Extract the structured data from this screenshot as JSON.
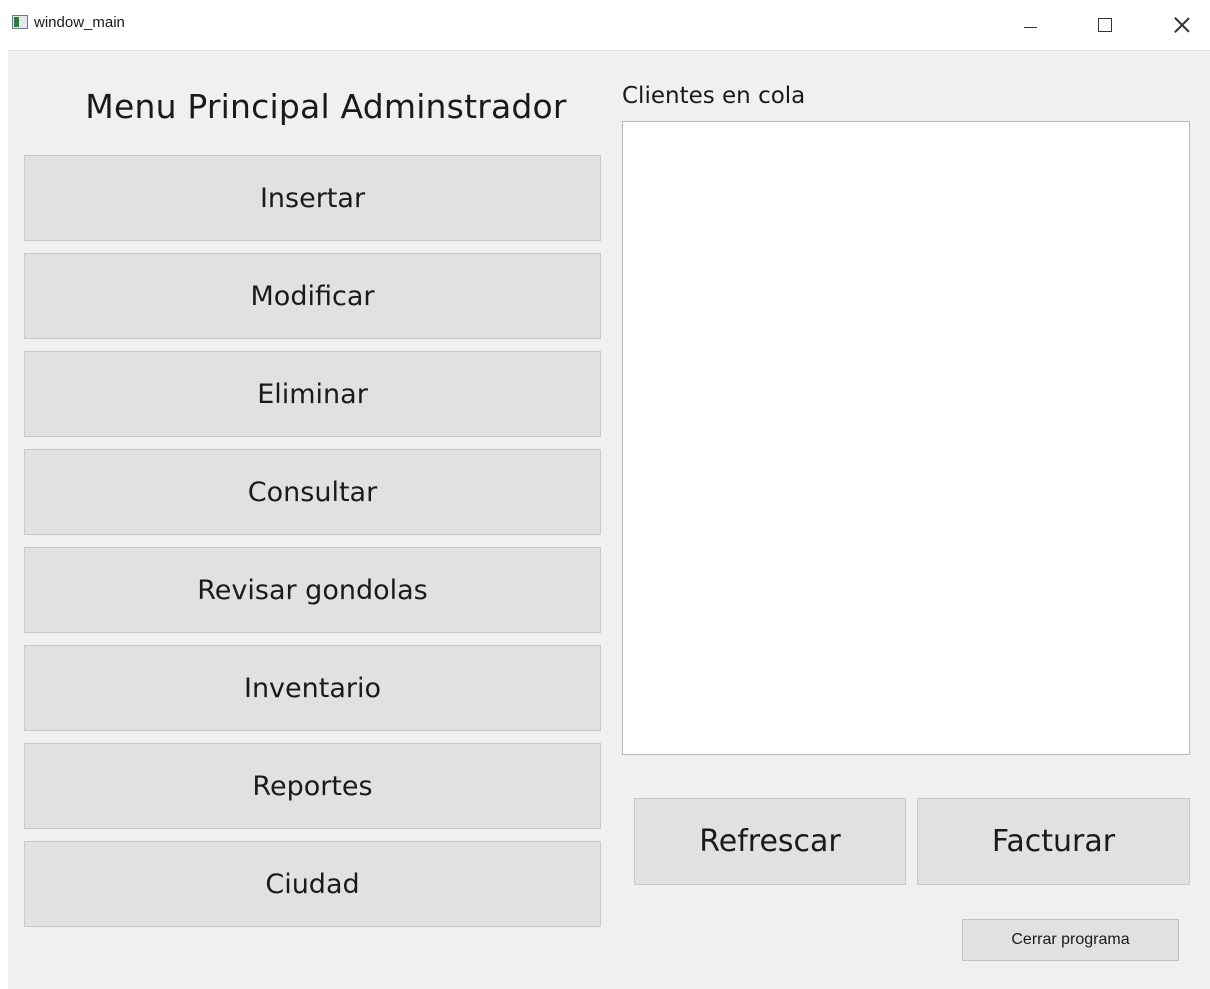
{
  "window": {
    "title": "window_main",
    "controls": {
      "minimize": "minimize-icon",
      "maximize": "maximize-icon",
      "close": "close-icon"
    }
  },
  "menu": {
    "title": "Menu Principal Adminstrador",
    "buttons": [
      {
        "label": "Insertar"
      },
      {
        "label": "Modificar"
      },
      {
        "label": "Eliminar"
      },
      {
        "label": "Consultar"
      },
      {
        "label": "Revisar gondolas"
      },
      {
        "label": "Inventario"
      },
      {
        "label": "Reportes"
      },
      {
        "label": "Ciudad"
      }
    ]
  },
  "queue": {
    "label": "Clientes en cola",
    "items": []
  },
  "actions": {
    "refresh_label": "Refrescar",
    "invoice_label": "Facturar",
    "close_program_label": "Cerrar programa"
  }
}
